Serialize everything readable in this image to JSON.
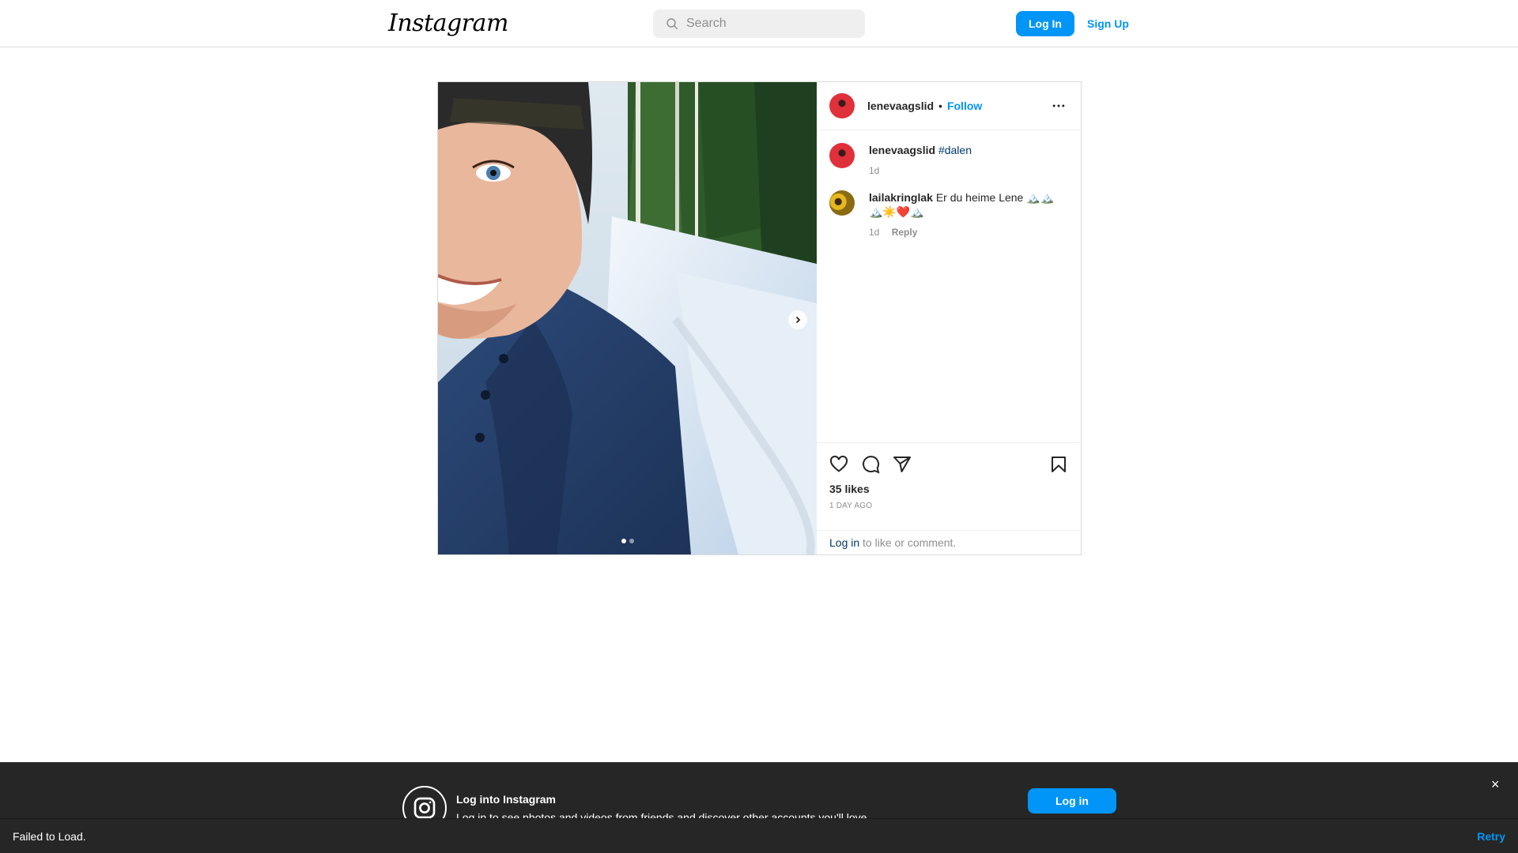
{
  "nav": {
    "logo": "Instagram",
    "search_placeholder": "Search",
    "login_label": "Log In",
    "signup_label": "Sign Up"
  },
  "post": {
    "author": "lenevaagslid",
    "separator": "•",
    "follow_label": "Follow",
    "caption": {
      "user": "lenevaagslid",
      "text": "#dalen",
      "time": "1d"
    },
    "comments": [
      {
        "user": "lailakringlak",
        "text": "Er du heime Lene 🏔️🏔️🏔️☀️❤️🏔️",
        "time": "1d",
        "reply_label": "Reply"
      }
    ],
    "likes": "35 likes",
    "posted_ago": "1 DAY AGO",
    "login_link": "Log in",
    "login_suffix": " to like or comment.",
    "carousel": {
      "count": 2,
      "active_index": 0
    }
  },
  "banner": {
    "title": "Log into Instagram",
    "subtitle": "Log in to see photos and videos from friends and discover other accounts you'll love.",
    "login_label": "Log in",
    "close_label": "×"
  },
  "toast": {
    "message": "Failed to Load.",
    "retry_label": "Retry"
  },
  "icons": {
    "search": "search-icon",
    "more": "more-horizontal-icon",
    "like": "heart-icon",
    "comment": "comment-bubble-icon",
    "share": "paper-plane-icon",
    "save": "bookmark-icon",
    "next": "chevron-right-icon",
    "instagram": "instagram-logo-icon",
    "close": "close-icon"
  },
  "colors": {
    "accent": "#0095f6",
    "link_dark": "#00376b",
    "banner_bg": "#262626",
    "border": "#dbdbdb"
  }
}
